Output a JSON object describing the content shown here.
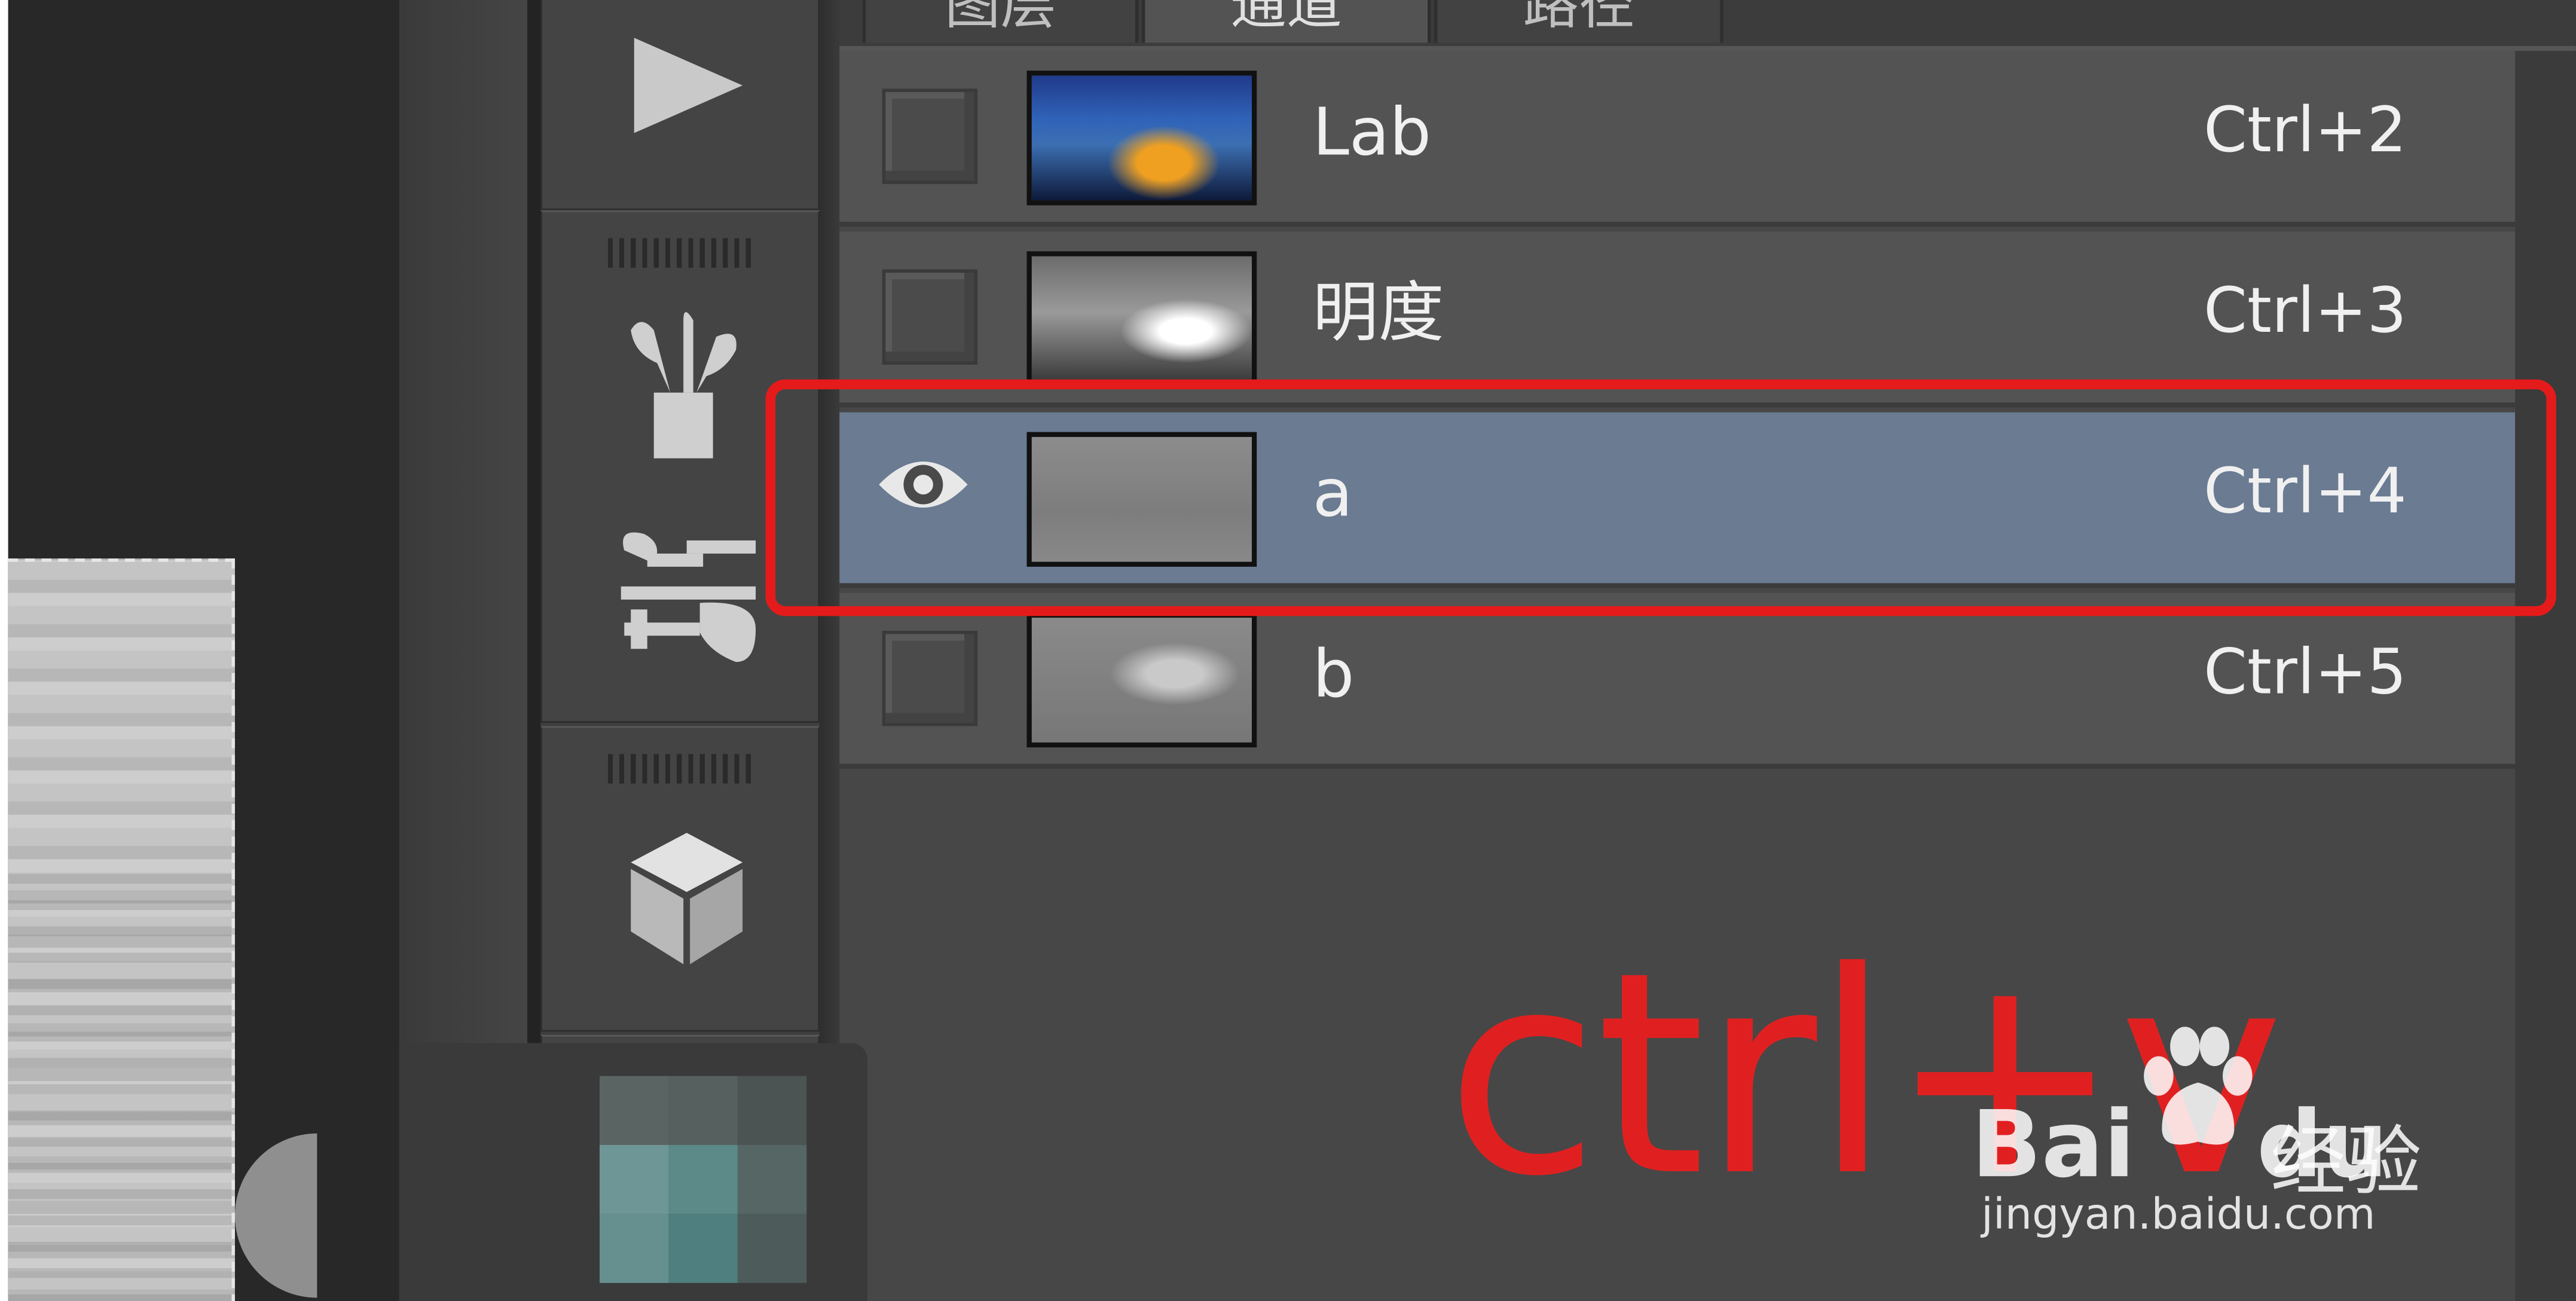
{
  "tabs": [
    {
      "label": "图层",
      "active": false
    },
    {
      "label": "通道",
      "active": true
    },
    {
      "label": "路径",
      "active": false
    }
  ],
  "channels": [
    {
      "name": "Lab",
      "shortcut": "Ctrl+2",
      "visible": false,
      "thumb": "color"
    },
    {
      "name": "明度",
      "shortcut": "Ctrl+3",
      "visible": false,
      "thumb": "lum"
    },
    {
      "name": "a",
      "shortcut": "Ctrl+4",
      "visible": true,
      "thumb": "chan-a",
      "selected": true
    },
    {
      "name": "b",
      "shortcut": "Ctrl+5",
      "visible": false,
      "thumb": "chan-b"
    }
  ],
  "toolbar": {
    "icons": [
      "play-icon",
      "brush-set-icon",
      "brush-presets-icon",
      "3d-cube-icon"
    ]
  },
  "annotation": {
    "text": "ctrl+v",
    "color": "#e02020"
  },
  "watermark": {
    "brand": "Bai",
    "brand2": "du",
    "cn": "经验",
    "url": "jingyan.baidu.com"
  },
  "colors": {
    "selected_row": "#6a7b92",
    "highlight_frame": "#e51b1b"
  }
}
